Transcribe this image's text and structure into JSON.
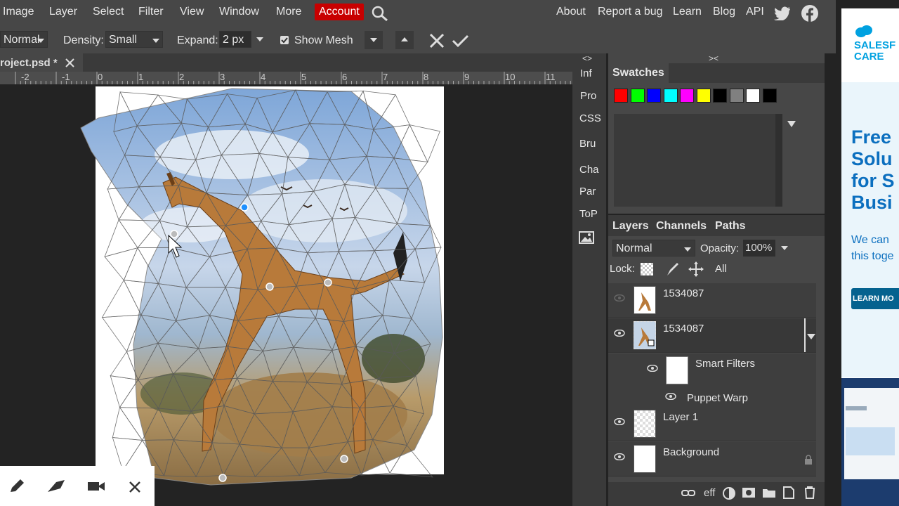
{
  "menu": {
    "items": [
      "Image",
      "Layer",
      "Select",
      "Filter",
      "View",
      "Window",
      "More"
    ],
    "account": "Account",
    "right_items": [
      "About",
      "Report a bug",
      "Learn",
      "Blog",
      "API"
    ]
  },
  "options": {
    "mode_value": "Normal",
    "density_label": "Density:",
    "density_value": "Small",
    "expand_label": "Expand:",
    "expand_value": "2 px",
    "show_mesh_label": "Show Mesh"
  },
  "document": {
    "tab_title": "roject.psd *",
    "ruler_numbers": [
      "-2",
      "-1",
      "0",
      "1",
      "2",
      "3",
      "4",
      "5",
      "6",
      "7",
      "8",
      "9",
      "10",
      "11"
    ]
  },
  "side_panel": {
    "buttons": [
      "Inf",
      "Pro",
      "CSS",
      "Bru",
      "Cha",
      "Par",
      "ToP"
    ],
    "collapse_left": "<>",
    "collapse_right": "><"
  },
  "swatches": {
    "title": "Swatches",
    "colors": [
      "#ff0000",
      "#00ff00",
      "#0000ff",
      "#00ffff",
      "#ff00ff",
      "#ffff00",
      "#000000",
      "#808080",
      "#ffffff",
      "#000000"
    ]
  },
  "layers": {
    "tabs": [
      "Layers",
      "Channels",
      "Paths"
    ],
    "blend_mode": "Normal",
    "opacity_label": "Opacity:",
    "opacity_value": "100%",
    "lock_label": "Lock:",
    "lock_all": "All",
    "rows": [
      {
        "name": "1534087"
      },
      {
        "name": "1534087"
      },
      {
        "name": "Smart Filters"
      },
      {
        "name": "Puppet Warp"
      },
      {
        "name": "Layer 1"
      },
      {
        "name": "Background"
      }
    ],
    "footer_eff": "eff"
  },
  "ad": {
    "brand": "SALESF CARE",
    "headline": "Free Solu for S Busi",
    "body": "We can this toge",
    "cta": "LEARN MO"
  }
}
